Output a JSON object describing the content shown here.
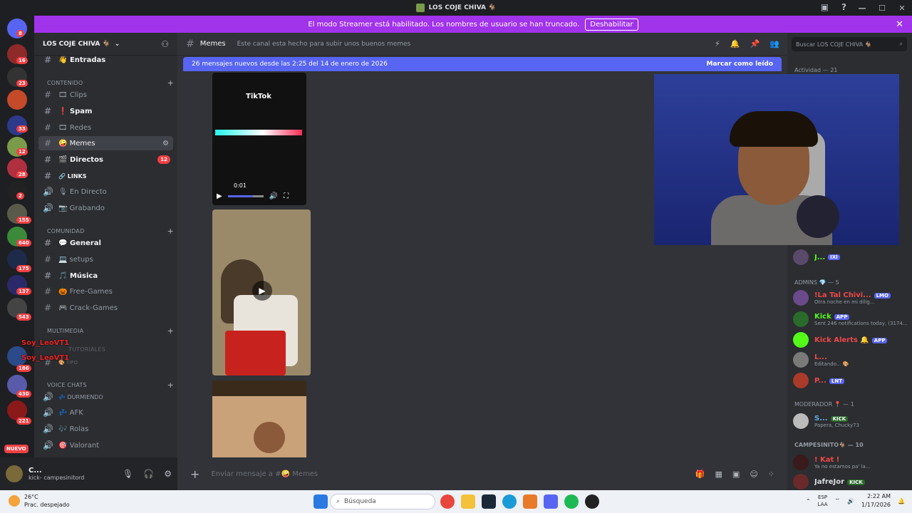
{
  "window": {
    "title": "LOS COJE CHIVA 🐐",
    "controls": [
      "—",
      "☐",
      "✕"
    ]
  },
  "banner": {
    "text": "El modo Streamer está habilitado. Los nombres de usuario se han truncado.",
    "button": "Deshabilitar"
  },
  "guilds": {
    "badges": [
      "8",
      "16",
      "23",
      "33",
      "12",
      "28",
      "2",
      "155",
      "640",
      "175",
      "137",
      "543",
      "186",
      "430",
      "221"
    ],
    "new_label": "NUEVO"
  },
  "server": {
    "name": "LOS COJE CHIVA 🐐",
    "channels": [
      {
        "label": "Entradas",
        "emoji": "👋"
      },
      {
        "label": "CONTENIDO",
        "kind": "category"
      },
      {
        "label": "Clips",
        "emoji": "🎞"
      },
      {
        "label": "Spam",
        "emoji": "❗"
      },
      {
        "label": "Redes",
        "emoji": "🎞"
      },
      {
        "label": "Memes",
        "emoji": "🤪"
      },
      {
        "label": "Directos",
        "emoji": "🎬",
        "count": "12"
      },
      {
        "label": "LINKS",
        "emoji": "🔗"
      },
      {
        "label": "En Directo",
        "emoji": "🎙"
      },
      {
        "label": "Grabando",
        "emoji": "📷"
      },
      {
        "label": "COMUNIDAD",
        "kind": "category"
      },
      {
        "label": "General",
        "emoji": "💬"
      },
      {
        "label": "setups",
        "emoji": "💻"
      },
      {
        "label": "Música",
        "emoji": "🎵"
      },
      {
        "label": "Free-Games",
        "emoji": "🎃"
      },
      {
        "label": "Crack-Games",
        "emoji": "🎮"
      },
      {
        "label": "MULTIMEDIA",
        "kind": "category"
      },
      {
        "label": "TUTORIALES",
        "kind": "category"
      },
      {
        "label": "TIPO",
        "emoji": "🎨"
      },
      {
        "label": "VOICE CHATS",
        "kind": "category"
      },
      {
        "label": "DURMIENDO",
        "emoji": "💤"
      },
      {
        "label": "AFK",
        "emoji": "💤"
      },
      {
        "label": "Rolas",
        "emoji": "🎶"
      },
      {
        "label": "Valorant",
        "emoji": "🎯"
      }
    ],
    "overlay_names": [
      "Soy_LeoVT1",
      "Soy_LeoVT1"
    ]
  },
  "user": {
    "name": "C...",
    "status": "kick- campesinitord"
  },
  "channel": {
    "name": "Memes",
    "topic": "Este canal esta hecho para subir unos buenos memes"
  },
  "new_messages": {
    "text": "26 mensajes nuevos desde las 2:25 del 14 de enero de 2026",
    "mark_read": "Marcar como leído"
  },
  "video1": {
    "logo": "TikTok",
    "time": "0:01",
    "progress": 0.7
  },
  "composer": {
    "placeholder": "Enviar mensaje a #🤪 Memes"
  },
  "members": {
    "search_placeholder": "Buscar LOS COJE CHIVA 🐐",
    "activity": "Actividad — 21",
    "groups": [
      {
        "title": "ADMINS 💎 — 5",
        "members": [
          {
            "name": "!La Tal Chivi...",
            "status": "Otra noche en mi dilig...",
            "tag": "LMO",
            "color": "#f04747"
          },
          {
            "name": "Kick",
            "status": "Sent 246 notifications today, (3174...",
            "tag": "APP",
            "color": "#53fc18"
          },
          {
            "name": "Kick Alerts 🔔",
            "status": "",
            "tag": "APP",
            "color": "#f04747"
          },
          {
            "name": "L...",
            "status": "Editando... 🎨",
            "tag": "",
            "color": "#f04747"
          },
          {
            "name": "P...",
            "status": "",
            "tag": "LNT",
            "color": "#f04747"
          }
        ]
      },
      {
        "title": "MODERADOR 📍 — 1",
        "members": [
          {
            "name": "S...",
            "status": "Papera, Chucky73",
            "tag": "KICK",
            "color": "#5dade2"
          }
        ]
      },
      {
        "title": "CAMPESINITO🐐 — 10",
        "members": [
          {
            "name": "! Kat !",
            "status": "Ya no estamos pa' la...",
            "tag": "",
            "color": "#f04747"
          },
          {
            "name": "JafreJor",
            "status": "",
            "tag": "KICK",
            "color": "#dbdee1"
          }
        ]
      }
    ],
    "top_member": {
      "name": "J...",
      "tag": "IXI"
    }
  },
  "taskbar": {
    "weather_temp": "26°C",
    "weather_desc": "Prac. despejado",
    "search": "Búsqueda",
    "lang1": "ESP",
    "lang2": "LAA",
    "time": "2:22 AM",
    "date": "1/17/2026"
  },
  "colors": {
    "banner": "#a133eb",
    "blurple": "#5865f2",
    "badge_red": "#f23f43"
  }
}
